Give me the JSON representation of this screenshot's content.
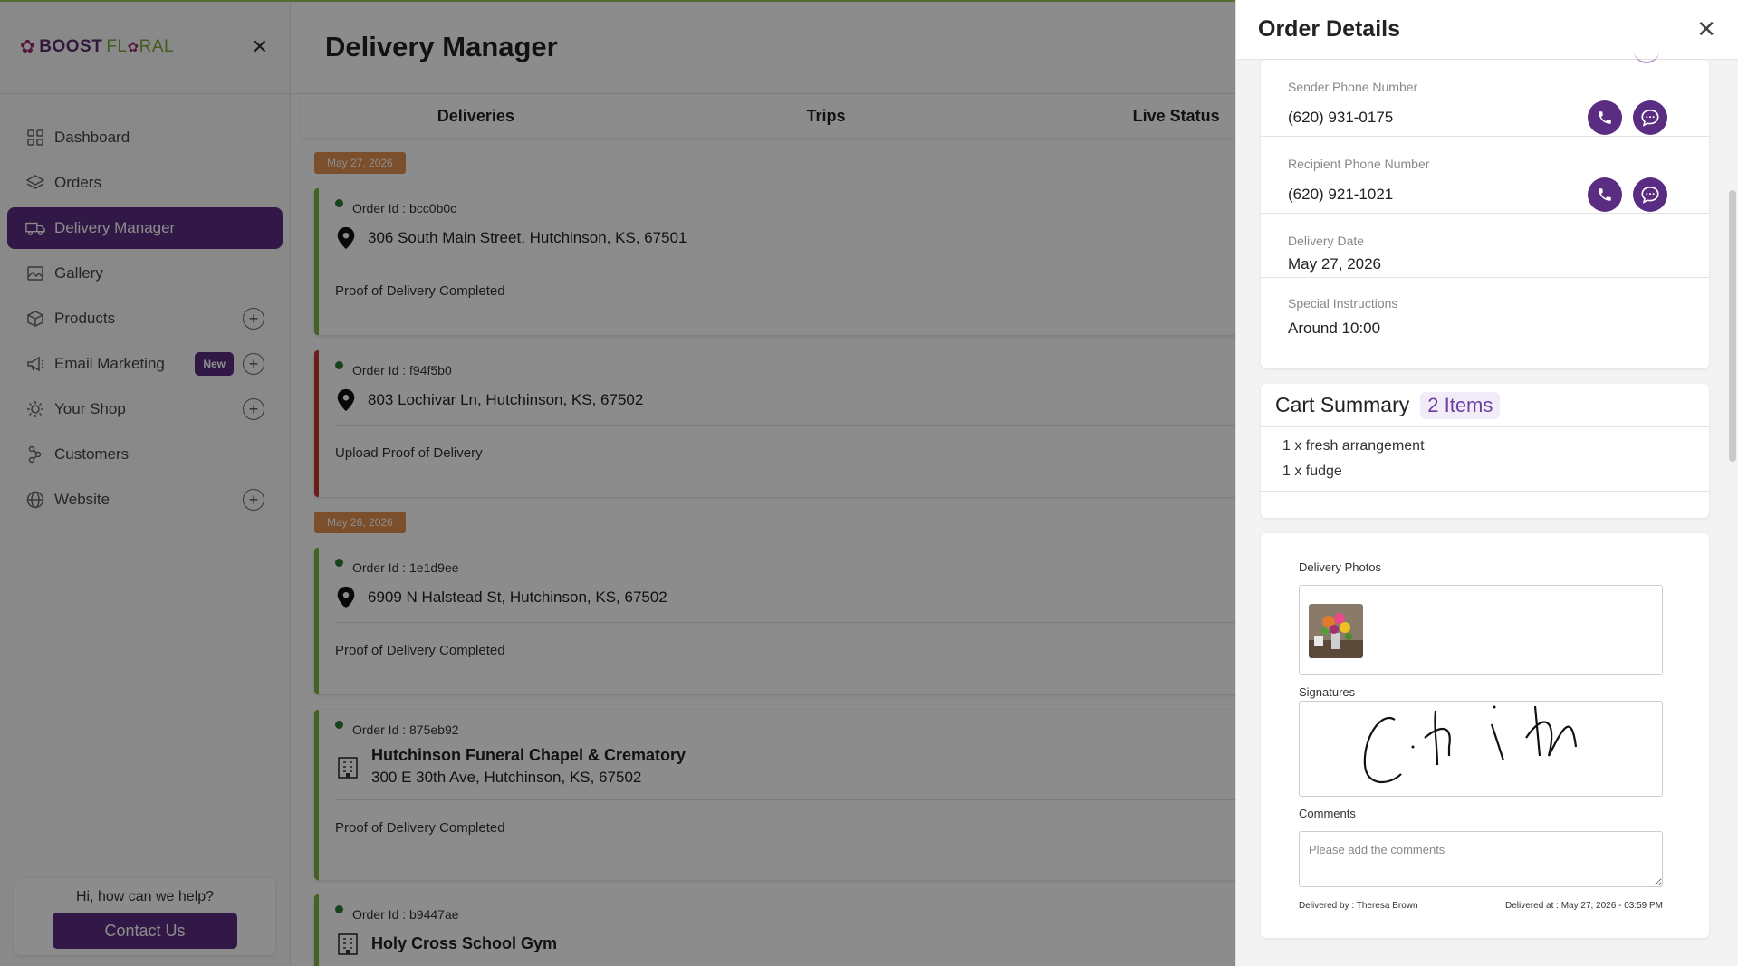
{
  "brand": {
    "part1": "BOOST",
    "part2a": "FL",
    "part2b": "RAL"
  },
  "sidebar": {
    "items": [
      {
        "label": "Dashboard"
      },
      {
        "label": "Orders"
      },
      {
        "label": "Delivery Manager"
      },
      {
        "label": "Gallery"
      },
      {
        "label": "Products"
      },
      {
        "label": "Email Marketing",
        "badge": "New"
      },
      {
        "label": "Your Shop"
      },
      {
        "label": "Customers"
      },
      {
        "label": "Website"
      }
    ],
    "help_text": "Hi, how can we help?",
    "contact_label": "Contact Us"
  },
  "main": {
    "title": "Delivery Manager",
    "tabs": [
      {
        "label": "Deliveries"
      },
      {
        "label": "Trips"
      },
      {
        "label": "Live Status"
      }
    ],
    "groups": [
      {
        "date": "May 27, 2026"
      },
      {
        "date": "May 26, 2026"
      }
    ],
    "orders": [
      {
        "order_id": "Order Id : bcc0b0c",
        "address": "306 South Main Street, Hutchinson, KS, 67501",
        "status": "Proof of Delivery Completed"
      },
      {
        "order_id": "Order Id : f94f5b0",
        "address": "803 Lochivar Ln, Hutchinson, KS, 67502",
        "status": "Upload Proof of Delivery"
      },
      {
        "order_id": "Order Id : 1e1d9ee",
        "address": "6909 N Halstead St, Hutchinson, KS, 67502",
        "status": "Proof of Delivery Completed"
      },
      {
        "order_id": "Order Id : 875eb92",
        "place": "Hutchinson Funeral Chapel & Crematory",
        "address": "300 E 30th Ave, Hutchinson, KS, 67502",
        "status": "Proof of Delivery Completed"
      },
      {
        "order_id": "Order Id : b9447ae",
        "place": "Holy Cross School Gym"
      }
    ]
  },
  "drawer": {
    "title": "Order Details",
    "sender_phone_label": "Sender Phone Number",
    "sender_phone": "(620) 931-0175",
    "recipient_phone_label": "Recipient Phone Number",
    "recipient_phone": "(620) 921-1021",
    "delivery_date_label": "Delivery Date",
    "delivery_date": "May 27, 2026",
    "instructions_label": "Special Instructions",
    "instructions": "Around 10:00",
    "cart": {
      "title": "Cart Summary",
      "count": "2 Items",
      "items": [
        "1 x fresh arrangement",
        "1 x fudge"
      ]
    },
    "photos_label": "Delivery Photos",
    "signatures_label": "Signatures",
    "comments_label": "Comments",
    "comments_placeholder": "Please add the comments",
    "delivered_by": "Delivered by : Theresa Brown",
    "delivered_at": "Delivered at : May 27, 2026 - 03:59 PM"
  },
  "colors": {
    "brand_purple": "#5a2d82",
    "date_chip": "#e0904f",
    "completed_border": "#7cb342",
    "pending_border": "#c0392b"
  }
}
